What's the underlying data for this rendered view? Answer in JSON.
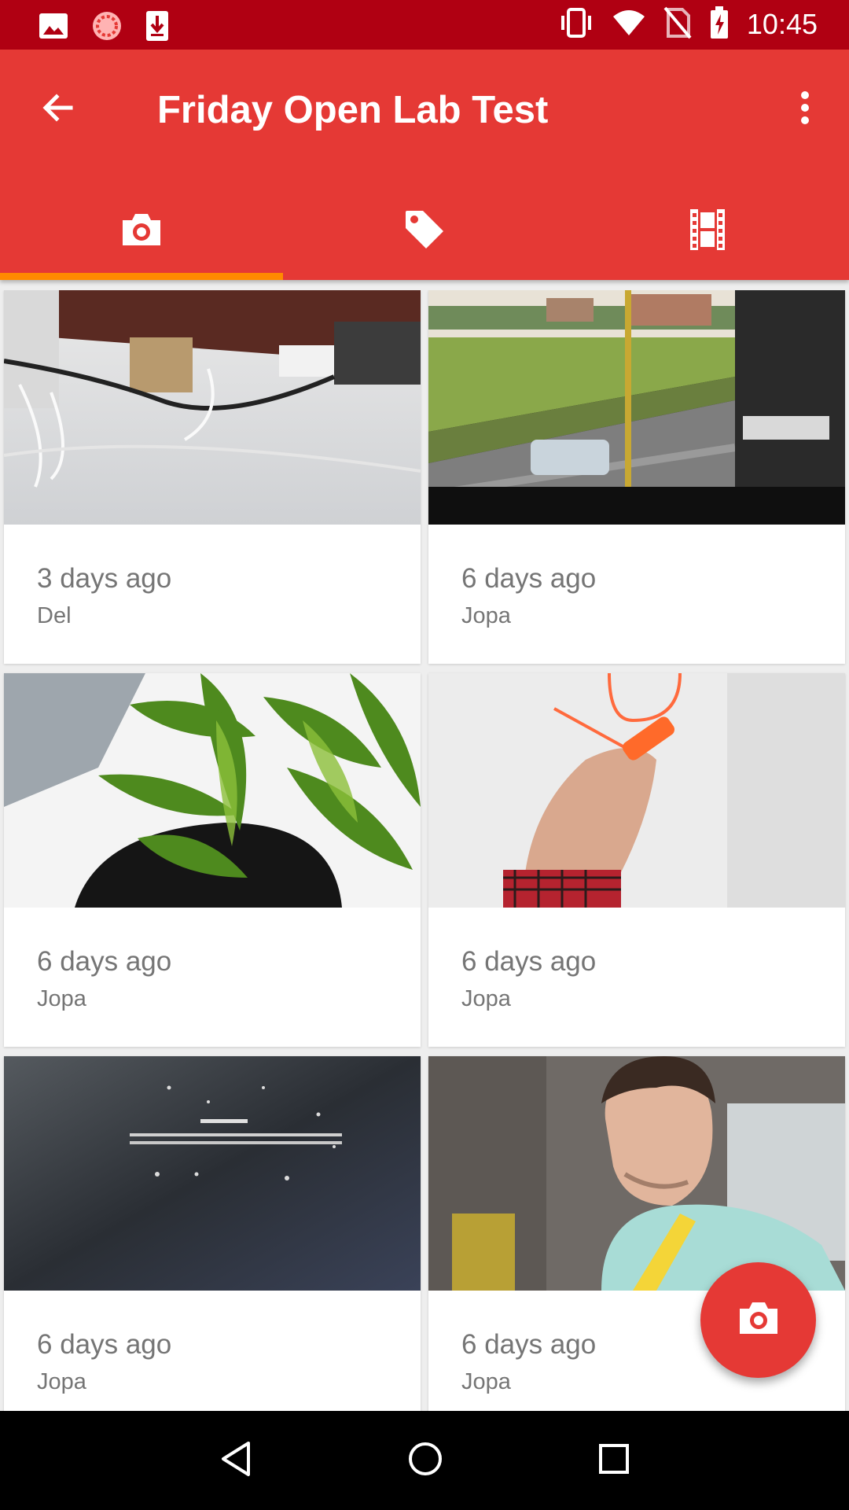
{
  "status_bar": {
    "time": "10:45",
    "left_icons": [
      "image-icon",
      "sync-icon",
      "download-icon"
    ],
    "right_icons": [
      "vibrate-icon",
      "wifi-icon",
      "no-sim-icon",
      "battery-charging-icon"
    ]
  },
  "app_bar": {
    "title": "Friday Open Lab Test",
    "back_icon": "arrow-back-icon",
    "overflow_icon": "more-vert-icon"
  },
  "tabs": [
    {
      "icon": "camera-icon",
      "selected": true
    },
    {
      "icon": "tag-icon",
      "selected": false
    },
    {
      "icon": "film-icon",
      "selected": false
    }
  ],
  "photos": [
    {
      "date": "3 days ago",
      "author": "Del"
    },
    {
      "date": "6 days ago",
      "author": "Jopa"
    },
    {
      "date": "6 days ago",
      "author": "Jopa"
    },
    {
      "date": "6 days ago",
      "author": "Jopa"
    },
    {
      "date": "6 days ago",
      "author": "Jopa"
    },
    {
      "date": "6 days ago",
      "author": "Jopa"
    }
  ],
  "fab": {
    "icon": "camera-icon"
  },
  "nav_bar": [
    "back-triangle-icon",
    "home-circle-icon",
    "recents-square-icon"
  ],
  "colors": {
    "primary": "#e53935",
    "status_bar": "#b00012",
    "tab_indicator": "#ff8a00"
  }
}
